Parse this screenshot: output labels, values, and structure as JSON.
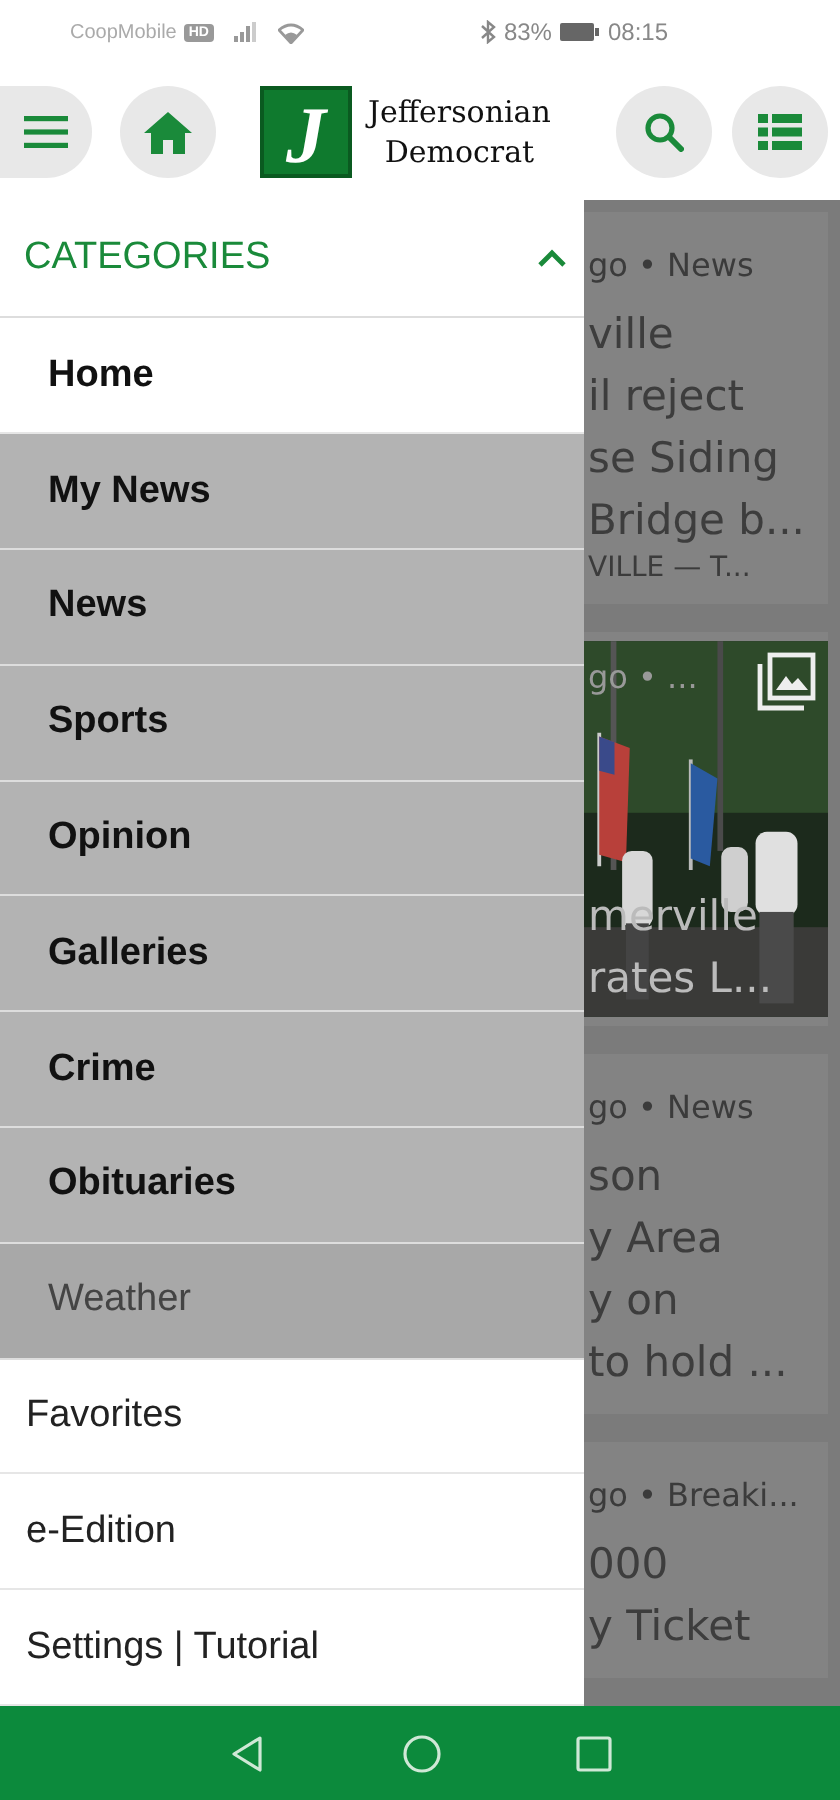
{
  "status_bar": {
    "carrier": "CoopMobile",
    "network_badge": "HD",
    "battery": "83%",
    "time": "08:15"
  },
  "header": {
    "logo": {
      "mark": "J",
      "name_lines": [
        "Jeffersonian",
        "Democrat"
      ]
    }
  },
  "drawer": {
    "section": {
      "label": "CATEGORIES",
      "expanded": true
    },
    "items": [
      {
        "label": "Home",
        "kind": "category",
        "bold": true,
        "shaded": false
      },
      {
        "label": "My News",
        "kind": "category",
        "bold": true,
        "shaded": true
      },
      {
        "label": "News",
        "kind": "category",
        "bold": true,
        "shaded": true
      },
      {
        "label": "Sports",
        "kind": "category",
        "bold": true,
        "shaded": true
      },
      {
        "label": "Opinion",
        "kind": "category",
        "bold": true,
        "shaded": true
      },
      {
        "label": "Galleries",
        "kind": "category",
        "bold": true,
        "shaded": true
      },
      {
        "label": "Crime",
        "kind": "category",
        "bold": true,
        "shaded": true
      },
      {
        "label": "Obituaries",
        "kind": "category",
        "bold": true,
        "shaded": true
      },
      {
        "label": "Weather",
        "kind": "category",
        "bold": false,
        "shaded": true
      },
      {
        "label": "Favorites",
        "kind": "link",
        "bold": false,
        "shaded": false
      },
      {
        "label": "e-Edition",
        "kind": "link",
        "bold": false,
        "shaded": false
      },
      {
        "label": "Settings | Tutorial",
        "kind": "link",
        "bold": false,
        "shaded": false
      }
    ]
  },
  "feed": {
    "cards": [
      {
        "kind": "text",
        "meta": "go • News",
        "title_lines": [
          "ville",
          "il reject",
          "se Siding",
          "Bridge b..."
        ],
        "snippet": "VILLE — T..."
      },
      {
        "meta": "go • ...",
        "title_lines": [
          "merville",
          "rates L..."
        ]
      },
      {
        "kind": "text",
        "meta": "go • News",
        "title_lines": [
          "son",
          "y Area",
          "y on",
          "to hold ..."
        ]
      },
      {
        "kind": "text",
        "meta": "go • Breaki...",
        "title_lines": [
          "000",
          "y Ticket"
        ]
      }
    ]
  }
}
